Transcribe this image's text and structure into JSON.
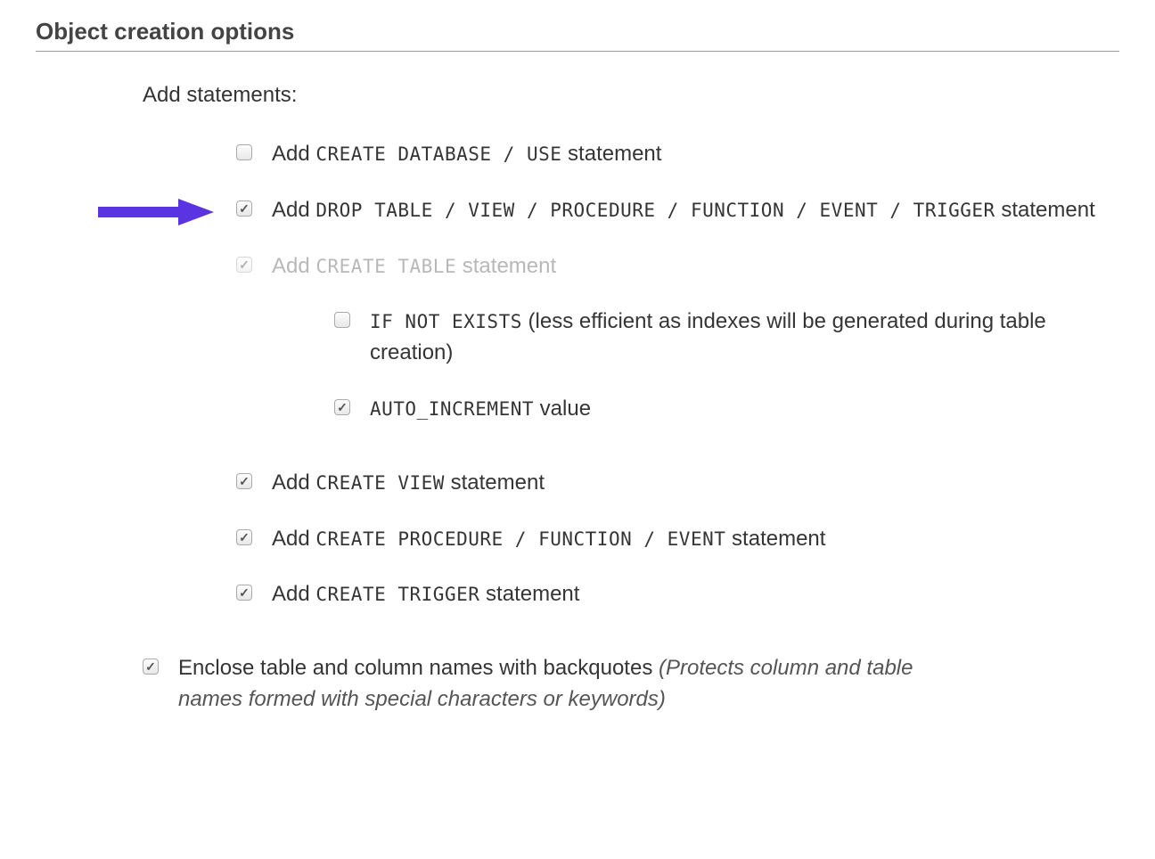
{
  "section": {
    "title": "Object creation options"
  },
  "groupTitle": "Add statements:",
  "options": {
    "createDb": {
      "prefix": "Add ",
      "code": "CREATE DATABASE / USE",
      "suffix": " statement"
    },
    "dropTable": {
      "prefix": "Add ",
      "code": "DROP TABLE / VIEW / PROCEDURE / FUNCTION / EVENT / TRIGGER",
      "suffix": " statement"
    },
    "createTable": {
      "prefix": "Add ",
      "code": "CREATE TABLE",
      "suffix": " statement"
    },
    "ifNotExists": {
      "code": "IF NOT EXISTS",
      "suffix": " (less efficient as indexes will be generated during table creation)"
    },
    "autoIncrement": {
      "code": "AUTO_INCREMENT",
      "suffix": " value"
    },
    "createView": {
      "prefix": "Add ",
      "code": "CREATE VIEW",
      "suffix": " statement"
    },
    "createProc": {
      "prefix": "Add ",
      "code": "CREATE PROCEDURE / FUNCTION / EVENT",
      "suffix": " statement"
    },
    "createTrigger": {
      "prefix": "Add ",
      "code": "CREATE TRIGGER",
      "suffix": " statement"
    },
    "backquotes": {
      "text": "Enclose table and column names with backquotes ",
      "hint": "(Protects column and table names formed with special characters or keywords)"
    }
  }
}
